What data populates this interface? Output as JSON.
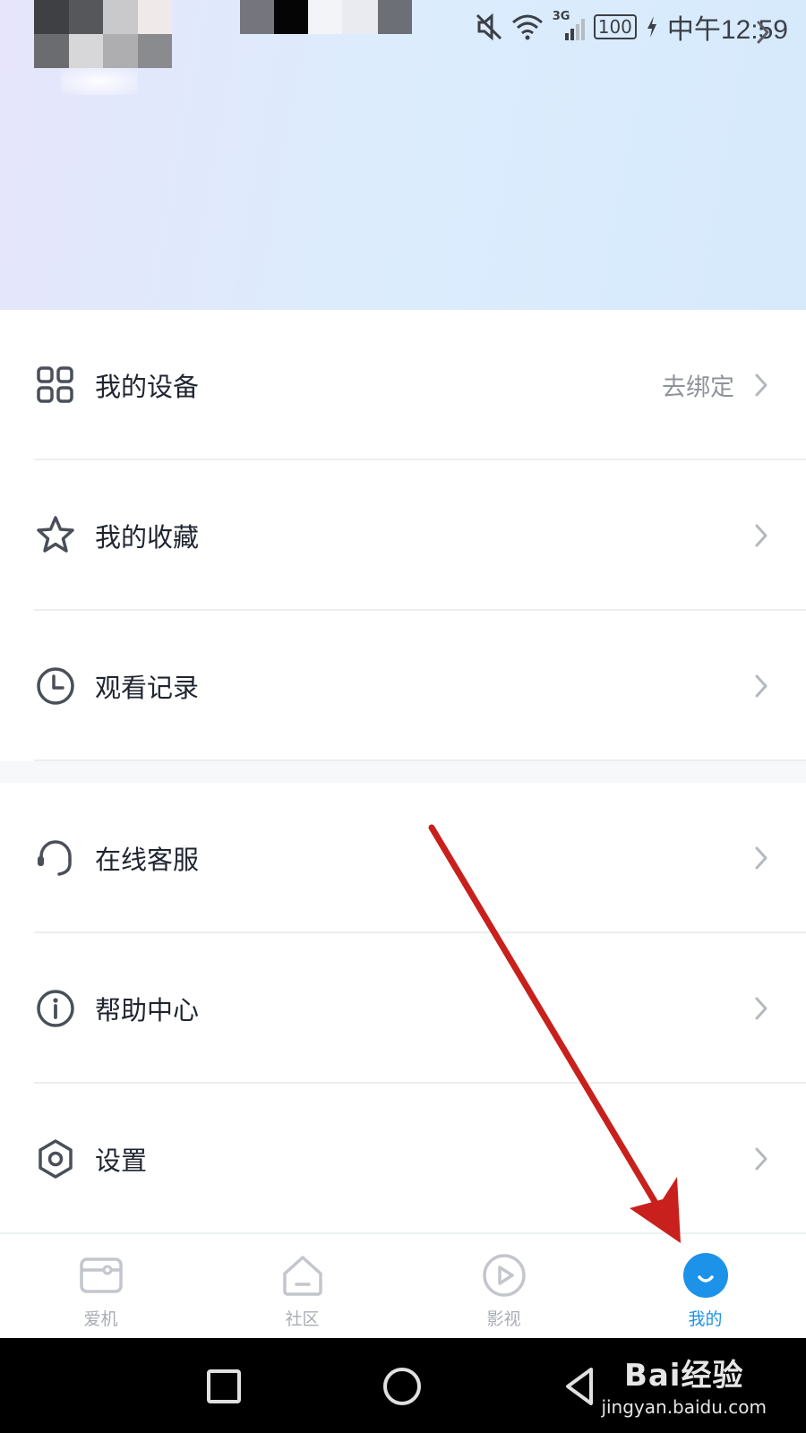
{
  "status_bar": {
    "battery": "100",
    "network": "3G",
    "time": "中午12:59"
  },
  "menu": {
    "groups": [
      {
        "items": [
          {
            "label": "我的设备",
            "value": "去绑定",
            "icon": "grid-apps-icon"
          },
          {
            "label": "我的收藏",
            "value": "",
            "icon": "star-icon"
          },
          {
            "label": "观看记录",
            "value": "",
            "icon": "clock-icon"
          }
        ]
      },
      {
        "items": [
          {
            "label": "在线客服",
            "value": "",
            "icon": "headset-icon"
          },
          {
            "label": "帮助中心",
            "value": "",
            "icon": "info-icon"
          },
          {
            "label": "设置",
            "value": "",
            "icon": "settings-hexagon-icon"
          }
        ]
      }
    ]
  },
  "tabbar": {
    "tabs": [
      {
        "label": "爱机",
        "icon": "tv-box-icon",
        "active": false
      },
      {
        "label": "社区",
        "icon": "home-icon",
        "active": false
      },
      {
        "label": "影视",
        "icon": "play-circle-icon",
        "active": false
      },
      {
        "label": "我的",
        "icon": "smile-face-icon",
        "active": true
      }
    ]
  },
  "watermark": {
    "logo": "Bai经验",
    "url": "jingyan.baidu.com"
  },
  "colors": {
    "accent": "#1c93e8",
    "annotation_arrow": "#c8201c",
    "header_gradient_start": "#e6e5fb",
    "header_gradient_end": "#d6eafc"
  }
}
